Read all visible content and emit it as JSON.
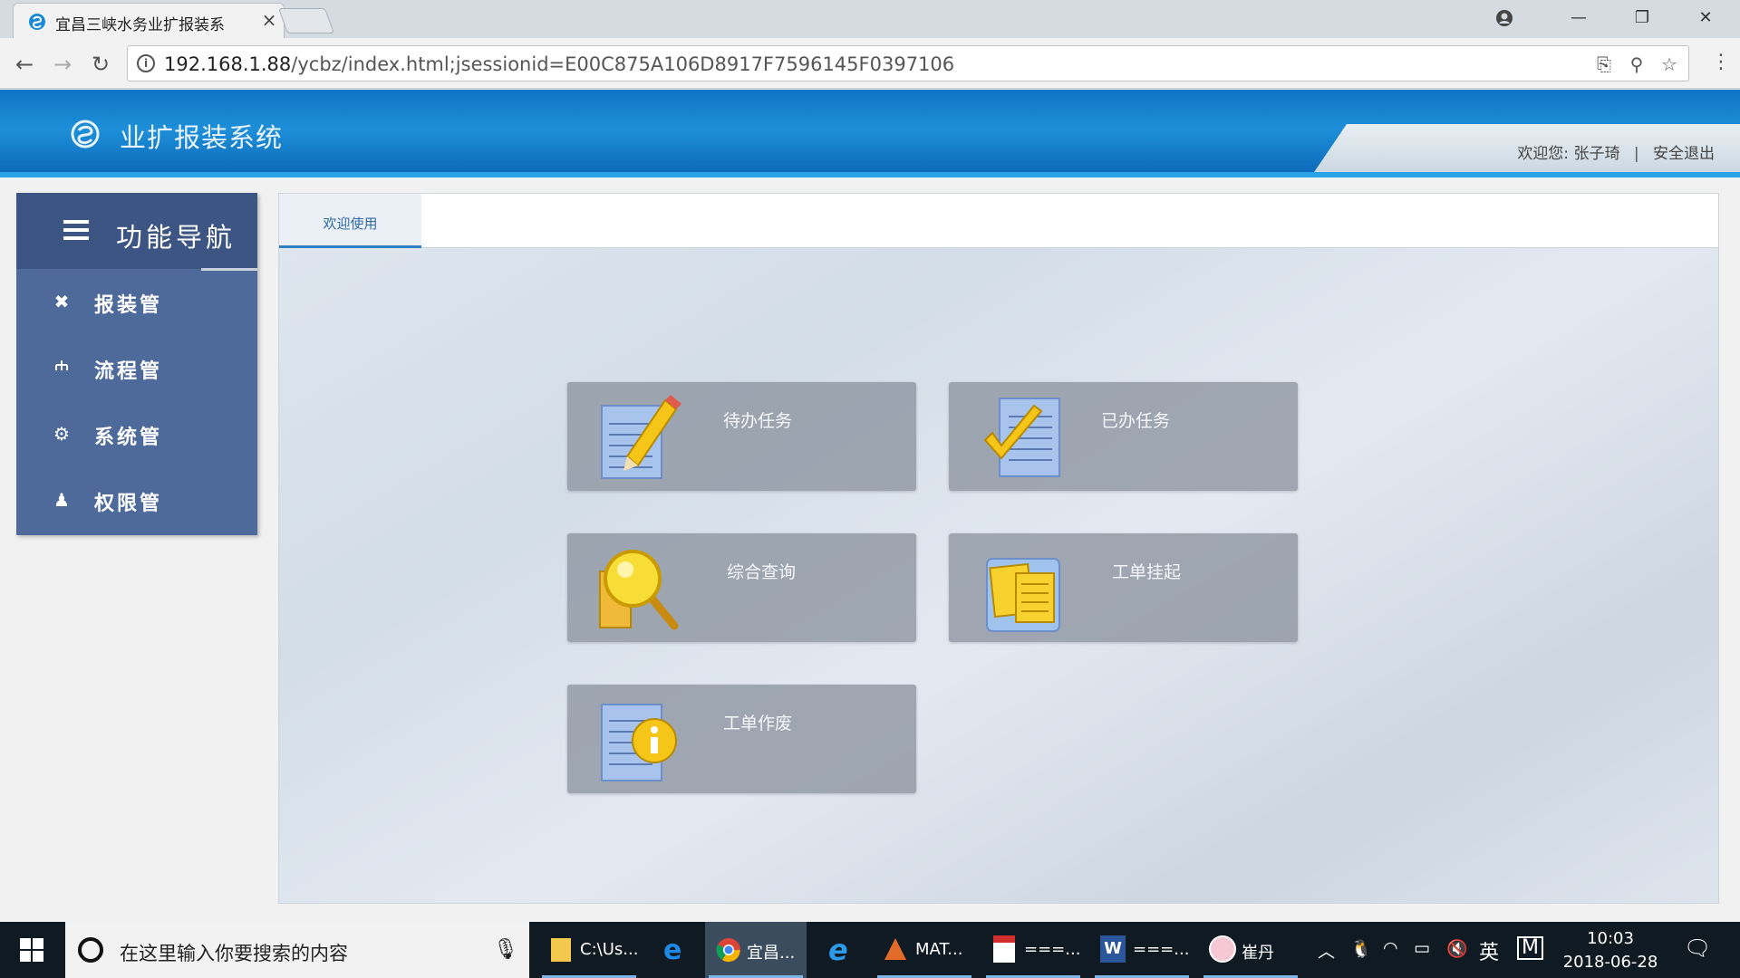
{
  "browser": {
    "tab_title": "宜昌三峡水务业扩报装系",
    "tab_close": "×",
    "url_host": "192.168.1.88",
    "url_rest": "/ycbz/index.html;jsessionid=E00C875A106D8917F7596145F0397106",
    "icons": [
      "back-icon",
      "forward-icon",
      "reload-icon",
      "info-icon",
      "translate-icon",
      "zoom-icon",
      "bookmark-star-icon",
      "menu-icon",
      "profile-icon",
      "minimize-icon",
      "maximize-icon",
      "close-icon"
    ]
  },
  "header": {
    "title": "业扩报装系统",
    "welcome_prefix": "欢迎您: 张子琦",
    "separator": "|",
    "logout": "安全退出"
  },
  "sidebar": {
    "title": "功能导航",
    "items": [
      {
        "label": "报装管",
        "icon": "wrench-icon"
      },
      {
        "label": "流程管",
        "icon": "flowchart-icon"
      },
      {
        "label": "系统管",
        "icon": "gear-icon"
      },
      {
        "label": "权限管",
        "icon": "user-key-icon"
      }
    ]
  },
  "content": {
    "tab_welcome": "欢迎使用",
    "tiles": [
      {
        "label": "待办任务",
        "icon": "pending-task-icon"
      },
      {
        "label": "已办任务",
        "icon": "done-task-icon"
      },
      {
        "label": "综合查询",
        "icon": "search-query-icon"
      },
      {
        "label": "工单挂起",
        "icon": "suspend-order-icon"
      },
      {
        "label": "工单作废",
        "icon": "void-order-icon"
      }
    ]
  },
  "taskbar": {
    "search_placeholder": "在这里输入你要搜索的内容",
    "apps": [
      {
        "label": "C:\\Us...",
        "icon": "folder-icon"
      },
      {
        "label": "",
        "icon": "edge-icon"
      },
      {
        "label": "宜昌...",
        "icon": "chrome-icon"
      },
      {
        "label": "",
        "icon": "ie-icon"
      },
      {
        "label": "MAT...",
        "icon": "matlab-icon"
      },
      {
        "label": "===...",
        "icon": "pdf-icon"
      },
      {
        "label": "===...",
        "icon": "word-icon"
      },
      {
        "label": "崔丹",
        "icon": "chat-avatar-icon"
      }
    ],
    "ime": "英",
    "ime2": "M",
    "time": "10:03",
    "date": "2018-06-28"
  },
  "colors": {
    "header_blue": "#1a7fcb",
    "sidebar": "#4e6a9a",
    "sidebar_head": "#3c5582",
    "tile": "#8c94a0",
    "accent_tab": "#2f7fc1"
  }
}
